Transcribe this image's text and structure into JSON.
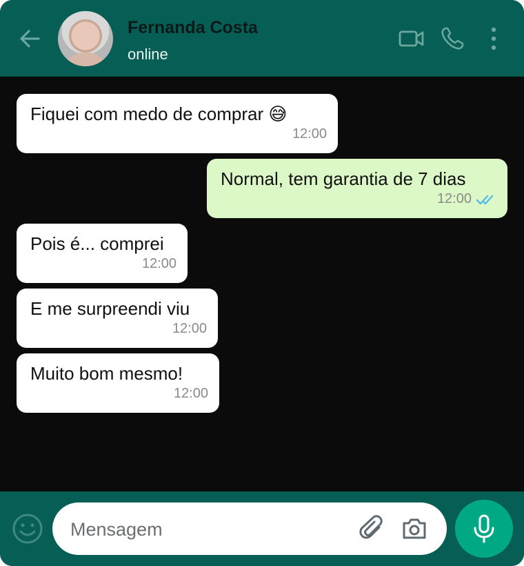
{
  "header": {
    "contact_name": "Fernanda Costa",
    "status": "online",
    "icons": {
      "back": "arrow-left-icon",
      "video": "video-call-icon",
      "call": "phone-icon",
      "more": "more-vertical-icon"
    }
  },
  "messages": [
    {
      "direction": "incoming",
      "text": "Fiquei com medo de comprar 😅",
      "time": "12:00"
    },
    {
      "direction": "outgoing",
      "text": "Normal, tem garantia de 7 dias",
      "time": "12:00",
      "read": true
    },
    {
      "direction": "incoming",
      "text": "Pois é... comprei",
      "time": "12:00"
    },
    {
      "direction": "incoming",
      "text": "E me surpreendi viu",
      "time": "12:00"
    },
    {
      "direction": "incoming",
      "text": "Muito bom mesmo!",
      "time": "12:00"
    }
  ],
  "composer": {
    "placeholder": "Mensagem",
    "icons": {
      "emoji": "emoji-icon",
      "attach": "paperclip-icon",
      "camera": "camera-icon",
      "mic": "microphone-icon"
    }
  },
  "colors": {
    "header": "#075e54",
    "chat_background": "#0b0b0b",
    "incoming_bubble": "#ffffff",
    "outgoing_bubble": "#dcf8c6",
    "read_check": "#53bdeb",
    "mic_button": "#00a884"
  }
}
